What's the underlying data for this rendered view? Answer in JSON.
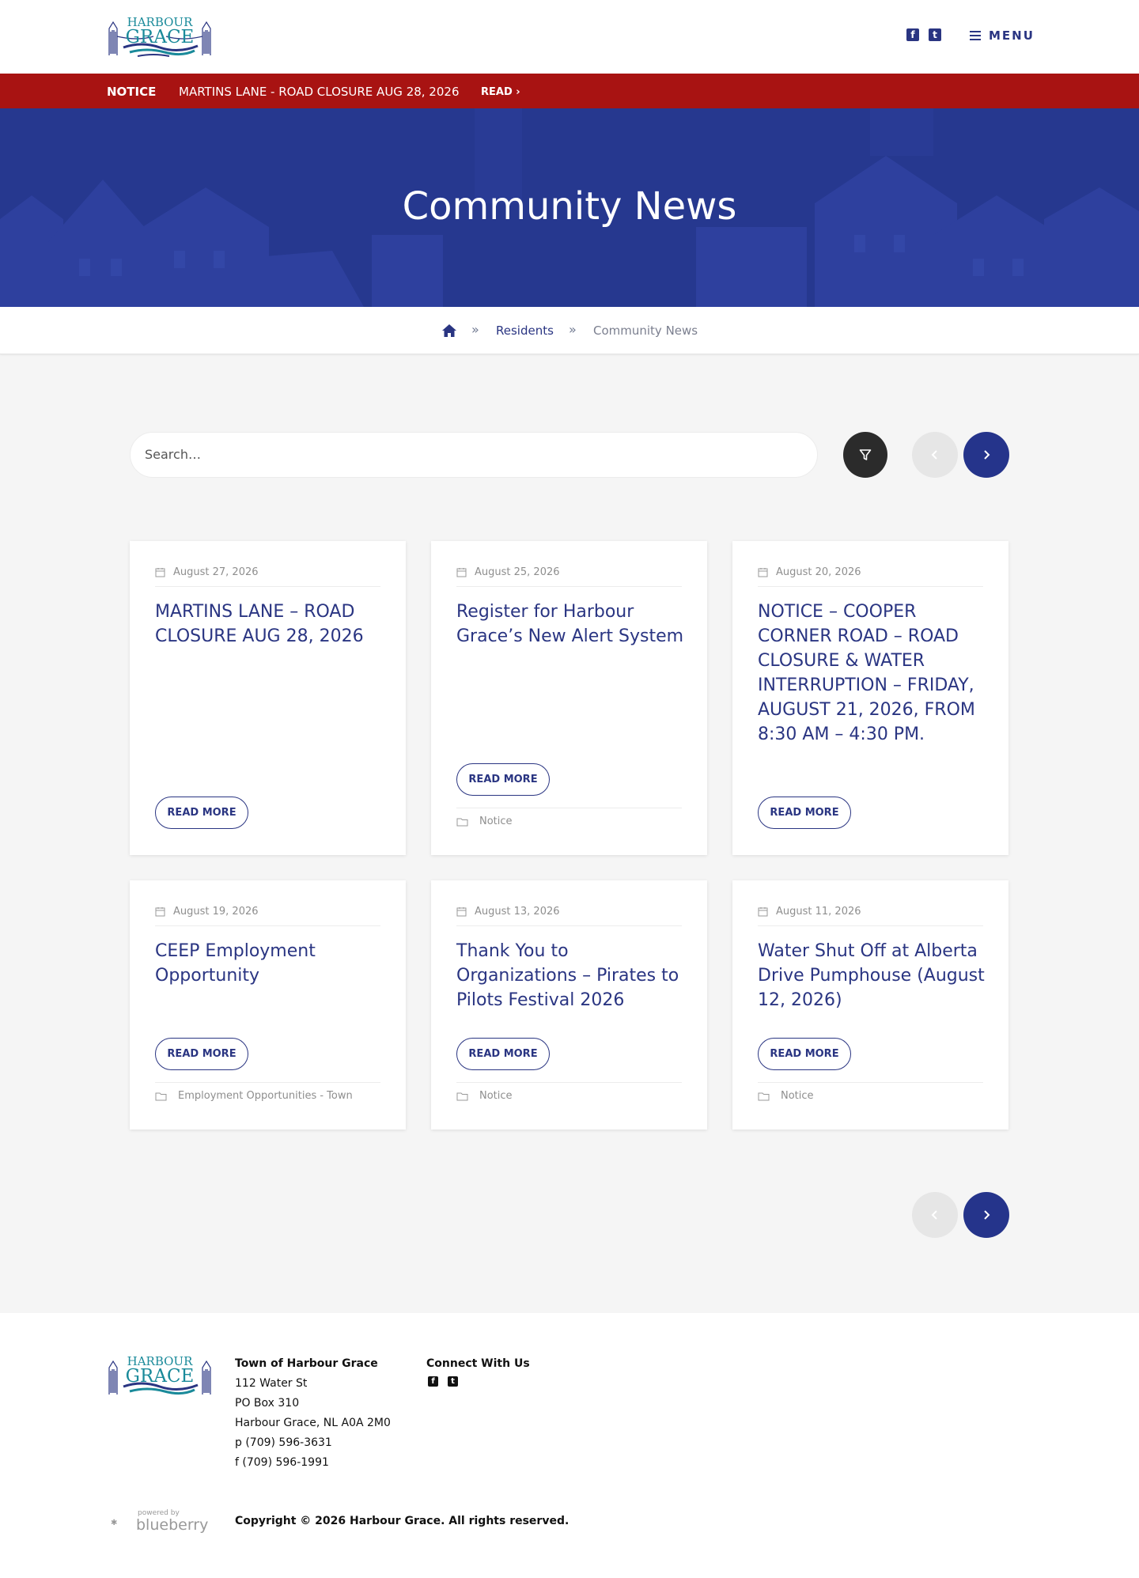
{
  "site": {
    "logo_text_top": "HARBOUR",
    "logo_text_bottom": "GRACE",
    "menu_label": "MENU",
    "social": [
      "facebook-icon",
      "twitter-icon"
    ]
  },
  "notice": {
    "tag": "NOTICE",
    "text": "MARTINS LANE - ROAD CLOSURE AUG 28, 2026",
    "read_label": "READ ›"
  },
  "hero": {
    "title": "Community News"
  },
  "breadcrumb": {
    "home_icon": "home-icon",
    "items": [
      "Residents",
      "Community News"
    ]
  },
  "search": {
    "placeholder": "Search…"
  },
  "cards": [
    {
      "date": "August 27, 2026",
      "title": "MARTINS LANE – ROAD CLOSURE AUG 28, 2026",
      "button": "READ MORE",
      "category": ""
    },
    {
      "date": "August 25, 2026",
      "title": "Register for Harbour Grace’s New Alert System",
      "button": "READ MORE",
      "category": "Notice"
    },
    {
      "date": "August 20, 2026",
      "title": "NOTICE – COOPER CORNER ROAD – ROAD CLOSURE & WATER INTERRUPTION – FRIDAY, AUGUST 21, 2026, FROM 8:30 AM – 4:30 PM.",
      "button": "READ MORE",
      "category": ""
    },
    {
      "date": "August 19, 2026",
      "title": "CEEP Employment Opportunity",
      "button": "READ MORE",
      "category": "Employment Opportunities - Town"
    },
    {
      "date": "August 13, 2026",
      "title": "Thank You to Organizations – Pirates to Pilots Festival 2026",
      "button": "READ MORE",
      "category": "Notice"
    },
    {
      "date": "August 11, 2026",
      "title": "Water Shut Off at Alberta Drive Pumphouse (August 12, 2026)",
      "button": "READ MORE",
      "category": "Notice"
    }
  ],
  "footer": {
    "org_name": "Town of Harbour Grace",
    "address1": "112 Water St",
    "address2": "PO Box 310",
    "address3": "Harbour Grace, NL A0A 2M0",
    "phone": "p (709) 596-3631",
    "fax": "f (709) 596-1991",
    "connect_heading": "Connect With Us",
    "powered_by": "powered by",
    "powered_brand": "blueberry",
    "copyright": "Copyright © 2026 Harbour Grace. All rights reserved."
  },
  "colors": {
    "brand_navy": "#2a3582",
    "notice_red": "#a81312",
    "hero_blue": "#26388f",
    "logo_teal": "#1a8a9a"
  }
}
